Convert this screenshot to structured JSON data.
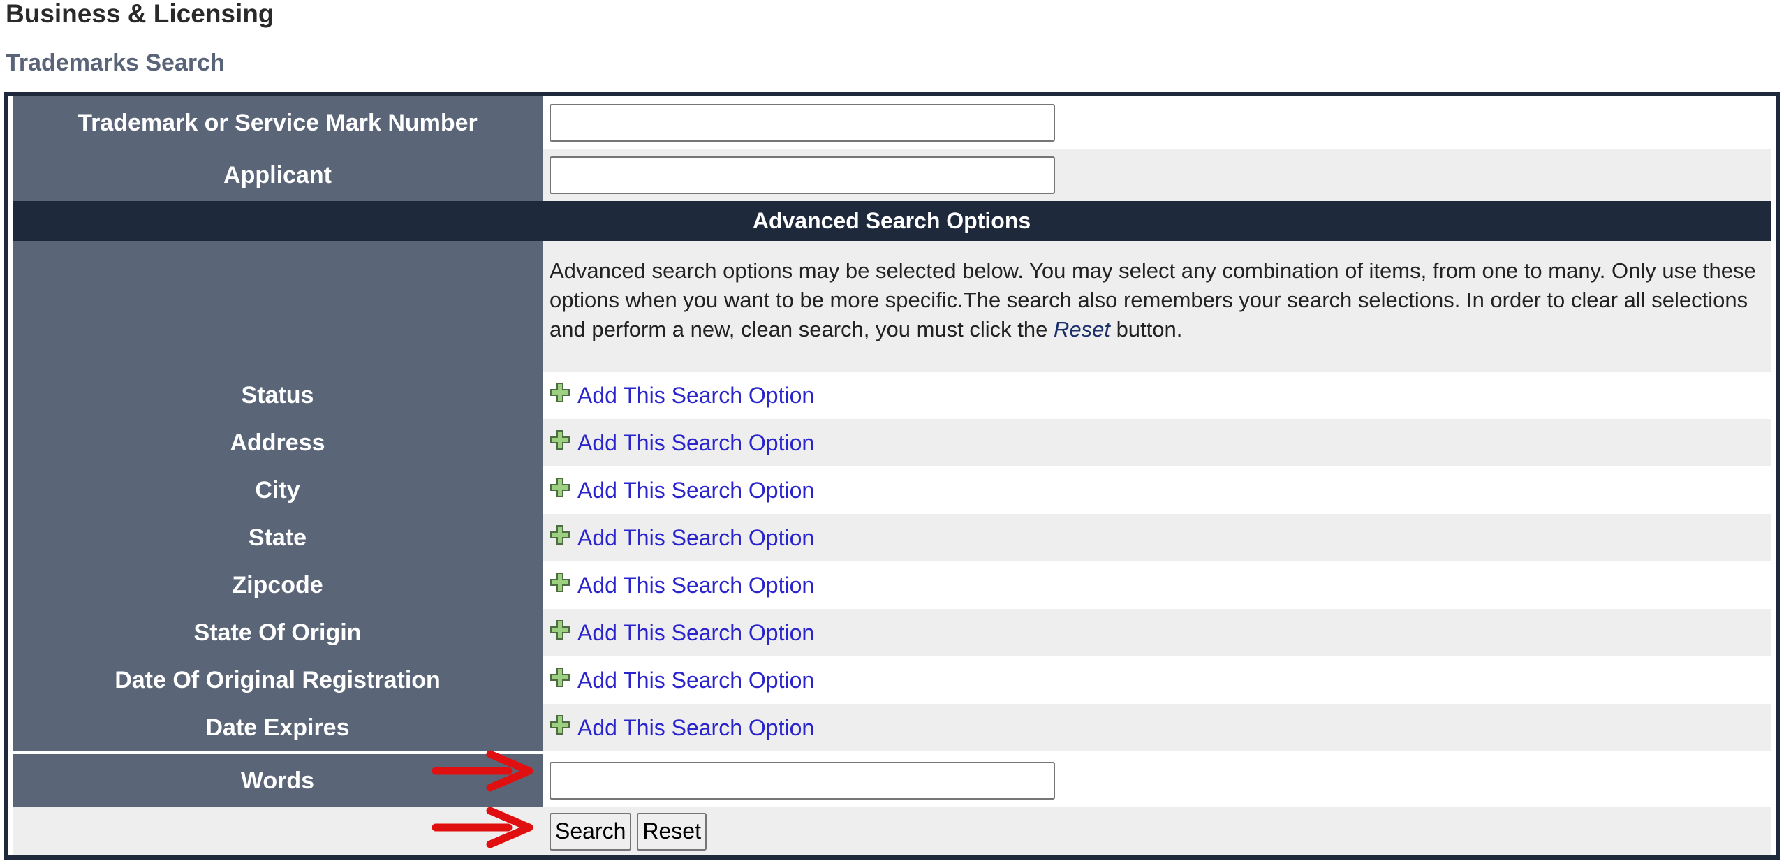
{
  "header": {
    "title": "Business & Licensing",
    "subtitle": "Trademarks Search"
  },
  "fields": {
    "mark_number_label": "Trademark or Service Mark Number",
    "mark_number_value": "",
    "applicant_label": "Applicant",
    "applicant_value": ""
  },
  "advanced": {
    "heading": "Advanced Search Options",
    "description_part1": "Advanced search options may be selected below. You may select any combination of items, from one to many. Only use these options when you want to be more specific.The search also remembers your search selections. In order to clear all selections and perform a new, clean search, you must click the ",
    "description_reset": "Reset",
    "description_part2": " button.",
    "options": [
      {
        "label": "Status",
        "link": "Add This Search Option"
      },
      {
        "label": "Address",
        "link": "Add This Search Option"
      },
      {
        "label": "City",
        "link": "Add This Search Option"
      },
      {
        "label": "State",
        "link": "Add This Search Option"
      },
      {
        "label": "Zipcode",
        "link": "Add This Search Option"
      },
      {
        "label": "State Of Origin",
        "link": "Add This Search Option"
      },
      {
        "label": "Date Of Original Registration",
        "link": "Add This Search Option"
      },
      {
        "label": "Date Expires",
        "link": "Add This Search Option"
      }
    ],
    "words_label": "Words",
    "words_value": ""
  },
  "actions": {
    "search_label": "Search",
    "reset_label": "Reset"
  },
  "colors": {
    "label_bg": "#5a6577",
    "header_bg": "#1e2a3c",
    "link": "#2a24cc",
    "annotation_arrow": "#e01010"
  },
  "icons": {
    "add_option": "plus-icon",
    "annotation": "arrow-right-icon"
  }
}
